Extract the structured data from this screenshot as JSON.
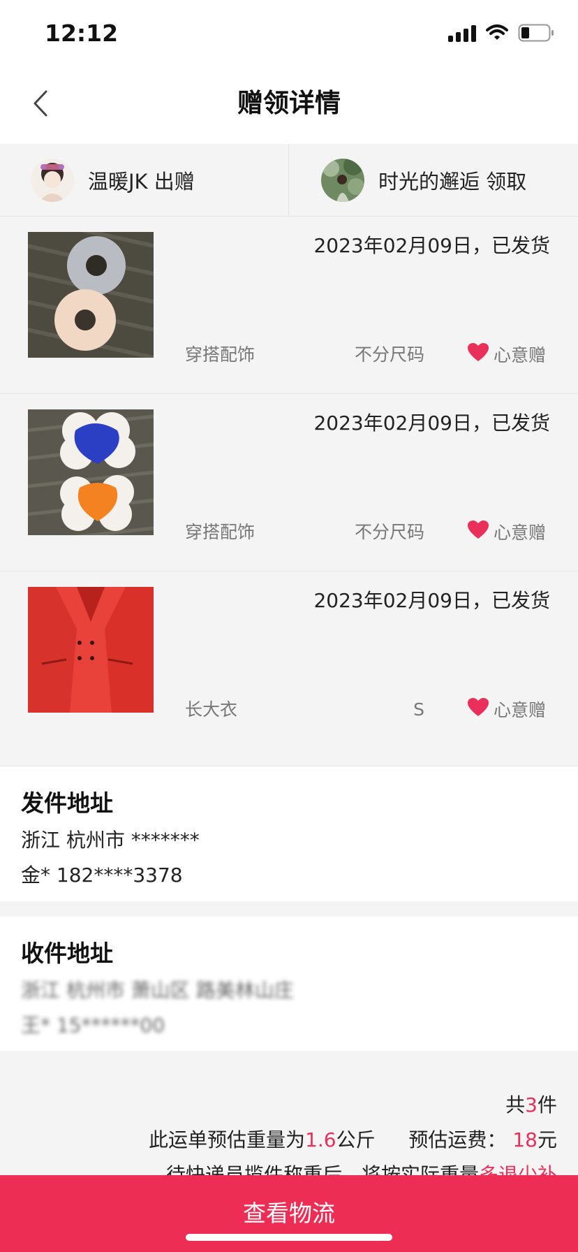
{
  "status_bar": {
    "time": "12:12"
  },
  "nav": {
    "title": "赠领详情"
  },
  "giver": {
    "text": "温暖JK 出赠"
  },
  "receiver": {
    "text": "时光的邂逅 领取"
  },
  "items": [
    {
      "date_status": "2023年02月09日，已发货",
      "category": "穿搭配饰",
      "size": "不分尺码",
      "tag": "心意赠"
    },
    {
      "date_status": "2023年02月09日，已发货",
      "category": "穿搭配饰",
      "size": "不分尺码",
      "tag": "心意赠"
    },
    {
      "date_status": "2023年02月09日，已发货",
      "category": "长大衣",
      "size": "S",
      "tag": "心意赠"
    }
  ],
  "sender_address": {
    "title": "发件地址",
    "line1": "浙江 杭州市 *******",
    "line2": "金* 182****3378"
  },
  "receiver_address": {
    "title": "收件地址",
    "line1": "浙江 杭州市 萧山区 路美林山庄",
    "line2": "王* 15******00"
  },
  "summary": {
    "count_prefix": "共",
    "count": "3",
    "count_suffix": "件",
    "weight_prefix": "此运单预估重量为",
    "weight": "1.6",
    "weight_unit": "公斤",
    "fee_label": "预估运费：",
    "fee": "18",
    "fee_unit": "元",
    "note_prefix": "待快递员揽件称重后，将按实际重量",
    "note_highlight": "多退少补"
  },
  "bottom_button": {
    "label": "查看物流"
  },
  "colors": {
    "accent": "#ee2d55",
    "highlight": "#e8305a"
  }
}
